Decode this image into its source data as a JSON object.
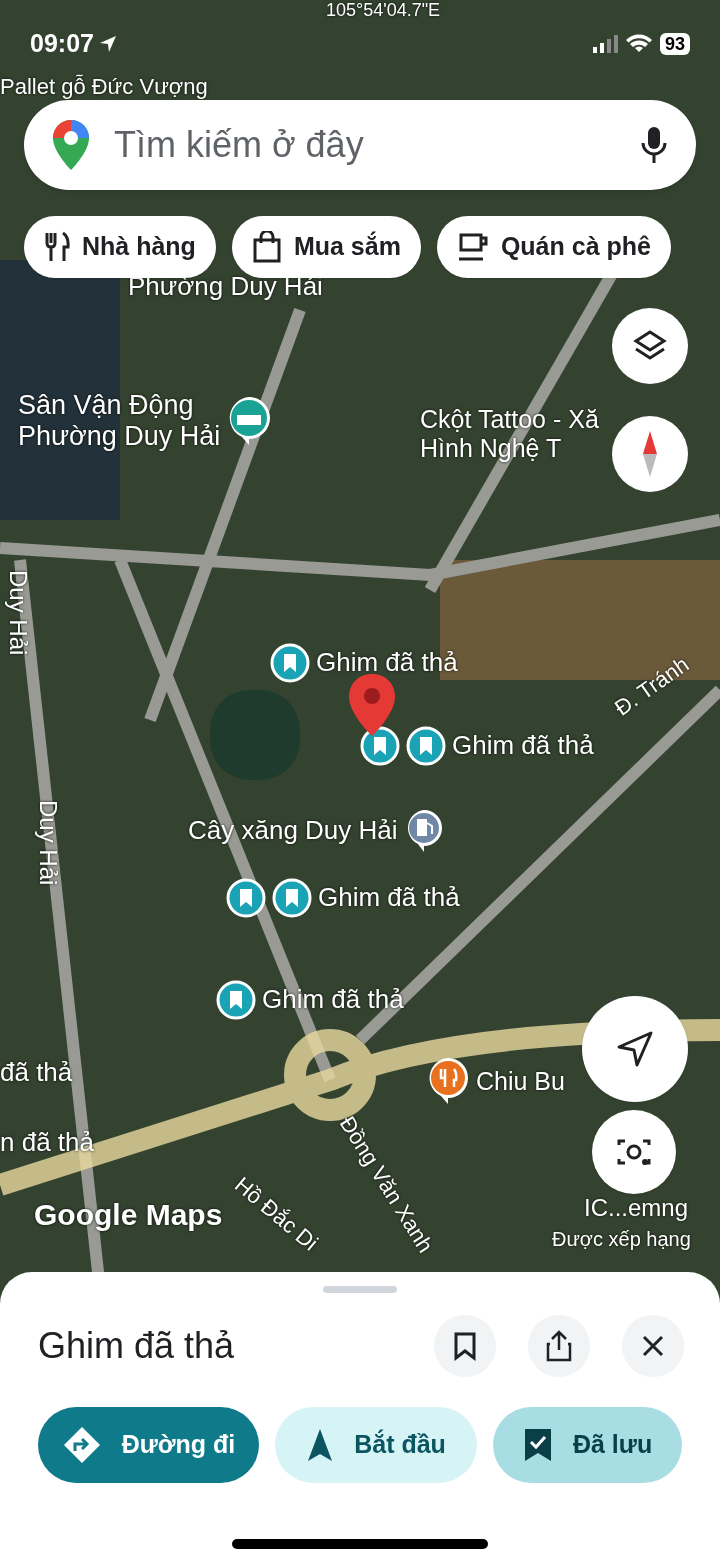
{
  "status_bar": {
    "time": "09:07",
    "battery": "93"
  },
  "search": {
    "placeholder": "Tìm kiếm ở đây"
  },
  "chips": [
    {
      "kind": "restaurant",
      "label": "Nhà hàng"
    },
    {
      "kind": "shopping",
      "label": "Mua sắm"
    },
    {
      "kind": "cafe",
      "label": "Quán cà phê"
    }
  ],
  "map": {
    "labels": [
      {
        "kind": "place",
        "text": "105°54'04.7\"E"
      },
      {
        "kind": "place",
        "text": "Pallet gỗ Đức Vượng"
      },
      {
        "kind": "place",
        "text": "Phường Duy Hải"
      },
      {
        "kind": "park",
        "text": "Sân Vận Động\nPhường Duy Hải"
      },
      {
        "kind": "place",
        "text": "Ckột Tattoo - Xă\nHình Nghệ T"
      },
      {
        "kind": "road",
        "text": "Duy Hải"
      },
      {
        "kind": "road",
        "text": "Duy Hải"
      },
      {
        "kind": "pin",
        "text": "Ghim đã thả"
      },
      {
        "kind": "pin",
        "text": "Ghim đã thả"
      },
      {
        "kind": "road",
        "text": "Đ. Tránh"
      },
      {
        "kind": "fuel",
        "text": "Cây xăng Duy Hải"
      },
      {
        "kind": "pin",
        "text": "Ghim đã thả"
      },
      {
        "kind": "pin",
        "text": "Ghim đã thả"
      },
      {
        "kind": "place",
        "text": "đã thả"
      },
      {
        "kind": "place",
        "text": "n đã thả"
      },
      {
        "kind": "food",
        "text": "Chiu Bu"
      },
      {
        "kind": "road",
        "text": "Đồng Văn Xanh"
      },
      {
        "kind": "road",
        "text": "Hồ Đắc Di"
      },
      {
        "kind": "logo",
        "text": "Google Maps"
      },
      {
        "kind": "place",
        "text": "IC...emng"
      },
      {
        "kind": "small",
        "text": "Được xếp hạng"
      }
    ]
  },
  "sheet": {
    "title": "Ghim đã thả",
    "actions": [
      {
        "kind": "directions",
        "label": "Đường đi"
      },
      {
        "kind": "start",
        "label": "Bắt đầu"
      },
      {
        "kind": "saved",
        "label": "Đã lưu"
      }
    ]
  }
}
